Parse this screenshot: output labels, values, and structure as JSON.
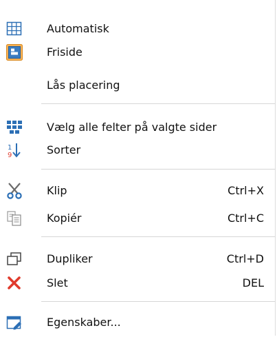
{
  "menu": {
    "items": [
      {
        "label": "Automatisk",
        "icon": "grid-icon",
        "shortcut": ""
      },
      {
        "label": "Friside",
        "icon": "free-page-icon",
        "shortcut": ""
      },
      {
        "label": "Lås placering",
        "icon": "",
        "shortcut": ""
      },
      {
        "label": "Vælg alle felter på valgte sider",
        "icon": "select-all-fields-icon",
        "shortcut": ""
      },
      {
        "label": "Sorter",
        "icon": "sort-icon",
        "shortcut": ""
      },
      {
        "label": "Klip",
        "icon": "scissors-icon",
        "shortcut": "Ctrl+X"
      },
      {
        "label": "Kopiér",
        "icon": "copy-icon",
        "shortcut": "Ctrl+C"
      },
      {
        "label": "Dupliker",
        "icon": "duplicate-icon",
        "shortcut": "Ctrl+D"
      },
      {
        "label": "Slet",
        "icon": "delete-icon",
        "shortcut": "DEL"
      },
      {
        "label": "Egenskaber...",
        "icon": "properties-icon",
        "shortcut": ""
      }
    ]
  },
  "colors": {
    "accent_blue": "#2c6fb5",
    "delete_red": "#e03a2c",
    "highlight_orange": "#f3a23a"
  }
}
